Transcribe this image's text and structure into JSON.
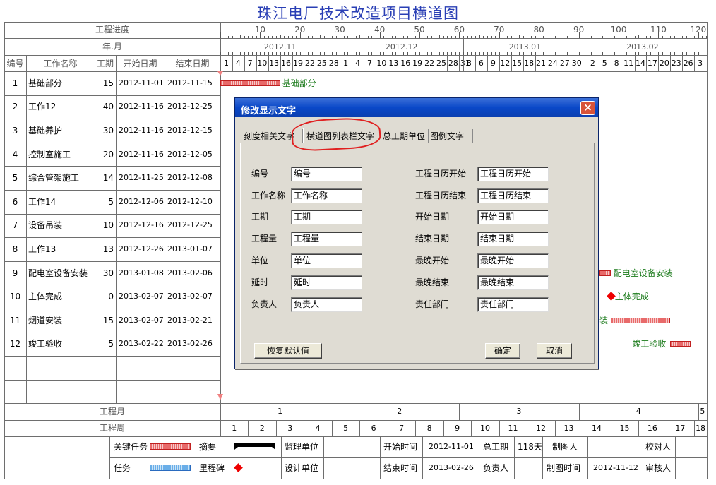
{
  "title": "珠江电厂技术改造项目横道图",
  "header": {
    "progress_label": "工程进度",
    "yearmonth_label": "年.月",
    "columns": [
      "编号",
      "工作名称",
      "工期",
      "开始日期",
      "结束日期"
    ],
    "progress_ticks": [
      "10",
      "20",
      "30",
      "40",
      "50",
      "60",
      "70",
      "80",
      "90",
      "100",
      "110",
      "120"
    ],
    "months": [
      "2012.11",
      "2012.12",
      "2013.01",
      "2013.02"
    ],
    "days_nov": [
      "1",
      "4",
      "7",
      "10",
      "13",
      "16",
      "19",
      "22",
      "25",
      "28"
    ],
    "days_dec": [
      "1",
      "4",
      "7",
      "10",
      "13",
      "16",
      "19",
      "22",
      "25",
      "28",
      "31"
    ],
    "days_jan": [
      "3",
      "6",
      "9",
      "12",
      "15",
      "18",
      "21",
      "24",
      "27",
      "30"
    ],
    "days_feb": [
      "2",
      "5",
      "8",
      "11",
      "14",
      "17",
      "20",
      "23",
      "26",
      "3"
    ]
  },
  "rows": [
    {
      "id": "1",
      "name": "基础部分",
      "dur": "15",
      "start": "2012-11-01",
      "end": "2012-11-15"
    },
    {
      "id": "2",
      "name": "工作12",
      "dur": "40",
      "start": "2012-11-16",
      "end": "2012-12-25"
    },
    {
      "id": "3",
      "name": "基础养护",
      "dur": "30",
      "start": "2012-11-16",
      "end": "2012-12-15"
    },
    {
      "id": "4",
      "name": "控制室施工",
      "dur": "20",
      "start": "2012-11-16",
      "end": "2012-12-05"
    },
    {
      "id": "5",
      "name": "综合管架施工",
      "dur": "14",
      "start": "2012-11-25",
      "end": "2012-12-08"
    },
    {
      "id": "6",
      "name": "工作14",
      "dur": "5",
      "start": "2012-12-06",
      "end": "2012-12-10"
    },
    {
      "id": "7",
      "name": "设备吊装",
      "dur": "10",
      "start": "2012-12-16",
      "end": "2012-12-25"
    },
    {
      "id": "8",
      "name": "工作13",
      "dur": "13",
      "start": "2012-12-26",
      "end": "2013-01-07"
    },
    {
      "id": "9",
      "name": "配电室设备安装",
      "dur": "30",
      "start": "2013-01-08",
      "end": "2013-02-06"
    },
    {
      "id": "10",
      "name": "主体完成",
      "dur": "0",
      "start": "2013-02-07",
      "end": "2013-02-07"
    },
    {
      "id": "11",
      "name": "烟道安装",
      "dur": "15",
      "start": "2013-02-07",
      "end": "2013-02-21"
    },
    {
      "id": "12",
      "name": "竣工验收",
      "dur": "5",
      "start": "2013-02-22",
      "end": "2013-02-26"
    }
  ],
  "gantt_labels": {
    "r1": "基础部分",
    "r9": "配电室设备安装",
    "r10": "主体完成",
    "r11": "装",
    "r12": "竣工验收"
  },
  "footer": {
    "month_label": "工程月",
    "months": [
      "1",
      "2",
      "3",
      "4",
      "5"
    ],
    "week_label": "工程周",
    "weeks": [
      "1",
      "2",
      "3",
      "4",
      "5",
      "6",
      "7",
      "8",
      "9",
      "10",
      "11",
      "12",
      "13",
      "14",
      "15",
      "16",
      "17",
      "18"
    ],
    "legend": {
      "critical": "关键任务",
      "summary": "摘要",
      "task": "任务",
      "milestone": "里程碑"
    },
    "info": {
      "supervisor_label": "监理单位",
      "design_label": "设计单位",
      "start_time_label": "开始时间",
      "start_time": "2012-11-01",
      "end_time_label": "结束时间",
      "end_time": "2013-02-26",
      "total_dur_label": "总工期",
      "total_dur": "118天",
      "owner_label": "负责人",
      "drawer_label": "制图人",
      "draw_time_label": "制图时间",
      "draw_time": "2012-11-12",
      "checker_label": "校对人",
      "reviewer_label": "审核人"
    }
  },
  "dialog": {
    "title": "修改显示文字",
    "tabs": [
      "刻度相关文字",
      "横道图列表栏文字",
      "总工期单位",
      "图例文字"
    ],
    "active_tab": 1,
    "left_fields": [
      {
        "label": "编号",
        "value": "编号"
      },
      {
        "label": "工作名称",
        "value": "工作名称"
      },
      {
        "label": "工期",
        "value": "工期"
      },
      {
        "label": "工程量",
        "value": "工程量"
      },
      {
        "label": "单位",
        "value": "单位"
      },
      {
        "label": "延时",
        "value": "延时"
      },
      {
        "label": "负责人",
        "value": "负责人"
      }
    ],
    "right_fields": [
      {
        "label": "工程日历开始",
        "value": "工程日历开始"
      },
      {
        "label": "工程日历结束",
        "value": "工程日历结束"
      },
      {
        "label": "开始日期",
        "value": "开始日期"
      },
      {
        "label": "结束日期",
        "value": "结束日期"
      },
      {
        "label": "最晚开始",
        "value": "最晚开始"
      },
      {
        "label": "最晚结束",
        "value": "最晚结束"
      },
      {
        "label": "责任部门",
        "value": "责任部门"
      }
    ],
    "restore_button": "恢复默认值",
    "ok_button": "确定",
    "cancel_button": "取消"
  }
}
